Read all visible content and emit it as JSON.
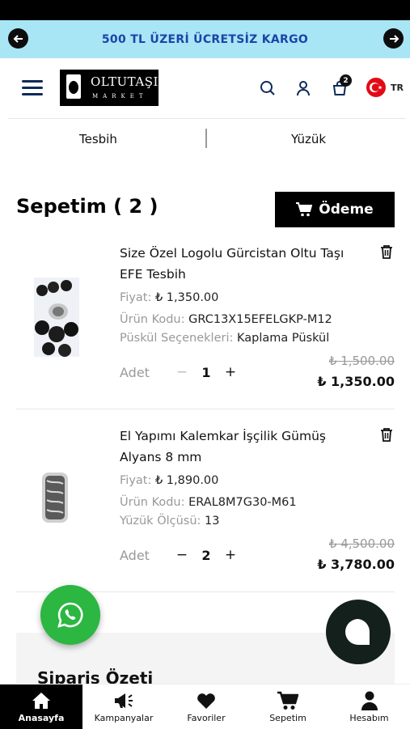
{
  "promo": {
    "text": "500 TL ÜZERİ ÜCRETSİZ KARGO"
  },
  "header": {
    "logo_name": "OLTUTAŞI",
    "logo_sub": "MARKET",
    "cart_count": "2",
    "language": "TR"
  },
  "categories": [
    "Tesbih",
    "Yüzük"
  ],
  "cart": {
    "title": "Sepetim ( 2 )",
    "checkout_label": "Ödeme"
  },
  "items": [
    {
      "name": "Size Özel Logolu Gürcistan Oltu Taşı EFE Tesbih",
      "price_label": "Fiyat:",
      "price": "₺ 1,350.00",
      "code_label": "Ürün Kodu:",
      "code": "GRC13X15EFELGKP-M12",
      "option_label": "Püskül Seçenekleri:",
      "option": "Kaplama Püskül",
      "qty_label": "Adet",
      "qty": "1",
      "old_total": "₺ 1,500.00",
      "total": "₺ 1,350.00"
    },
    {
      "name": "El Yapımı Kalemkar İşçilik Gümüş Alyans 8 mm",
      "price_label": "Fiyat:",
      "price": "₺ 1,890.00",
      "code_label": "Ürün Kodu:",
      "code": "ERAL8M7G30-M61",
      "option_label": "Yüzük Ölçüsü:",
      "option": "13",
      "qty_label": "Adet",
      "qty": "2",
      "old_total": "₺ 4,500.00",
      "total": "₺ 3,780.00"
    }
  ],
  "qty_minus": "−",
  "qty_plus": "+",
  "summary": {
    "title": "Sipariş Özeti"
  },
  "bottom_nav": [
    {
      "label": "Anasayfa",
      "icon": "home-icon",
      "active": true
    },
    {
      "label": "Kampanyalar",
      "icon": "megaphone-icon",
      "active": false
    },
    {
      "label": "Favoriler",
      "icon": "heart-icon",
      "active": false
    },
    {
      "label": "Sepetim",
      "icon": "cart-icon",
      "active": false
    },
    {
      "label": "Hesabım",
      "icon": "user-icon",
      "active": false
    }
  ],
  "colors": {
    "promo_bg": "#a8e6f6",
    "promo_text": "#1a45a8",
    "whatsapp": "#2bb741",
    "accent": "#000000"
  }
}
